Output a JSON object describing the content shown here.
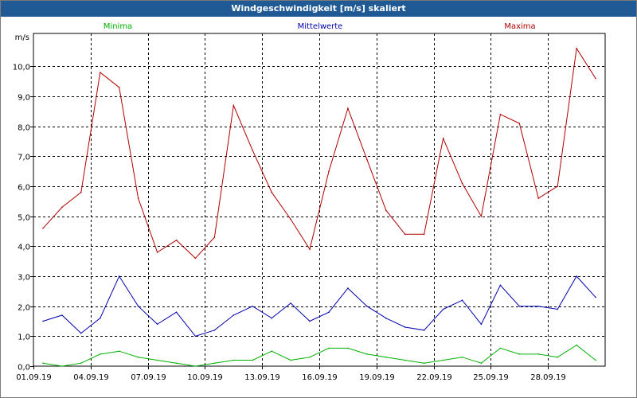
{
  "window": {
    "title": "Windgeschwindigkeit [m/s] skaliert"
  },
  "chart_data": {
    "type": "line",
    "y_unit_label": "m/s",
    "ylim": [
      0,
      11.1
    ],
    "y_ticks": [
      {
        "value": 0,
        "label": "0,0"
      },
      {
        "value": 1,
        "label": "1,0"
      },
      {
        "value": 2,
        "label": "2,0"
      },
      {
        "value": 3,
        "label": "3,0"
      },
      {
        "value": 4,
        "label": "4,0"
      },
      {
        "value": 5,
        "label": "5,0"
      },
      {
        "value": 6,
        "label": "6,0"
      },
      {
        "value": 7,
        "label": "7,0"
      },
      {
        "value": 8,
        "label": "8,0"
      },
      {
        "value": 9,
        "label": "9,0"
      },
      {
        "value": 10,
        "label": "10,0"
      }
    ],
    "x_ticks": [
      "01.09.19",
      "04.09.19",
      "07.09.19",
      "10.09.19",
      "13.09.19",
      "16.09.19",
      "19.09.19",
      "22.09.19",
      "25.09.19",
      "28.09.19"
    ],
    "xlim": [
      "2019-09-01",
      "2019-10-01"
    ],
    "grid": true,
    "legend_position": "top",
    "x": [
      "2019-09-01",
      "2019-09-02",
      "2019-09-03",
      "2019-09-04",
      "2019-09-05",
      "2019-09-06",
      "2019-09-07",
      "2019-09-08",
      "2019-09-09",
      "2019-09-10",
      "2019-09-11",
      "2019-09-12",
      "2019-09-13",
      "2019-09-14",
      "2019-09-15",
      "2019-09-16",
      "2019-09-17",
      "2019-09-18",
      "2019-09-19",
      "2019-09-20",
      "2019-09-21",
      "2019-09-22",
      "2019-09-23",
      "2019-09-24",
      "2019-09-25",
      "2019-09-26",
      "2019-09-27",
      "2019-09-28",
      "2019-09-29",
      "2019-09-30"
    ],
    "series": [
      {
        "name": "Minima",
        "color": "#00b000",
        "values": [
          0.1,
          0.0,
          0.1,
          0.4,
          0.5,
          0.3,
          0.2,
          0.1,
          0.0,
          0.1,
          0.2,
          0.2,
          0.5,
          0.2,
          0.3,
          0.6,
          0.6,
          0.4,
          0.3,
          0.2,
          0.1,
          0.2,
          0.3,
          0.1,
          0.6,
          0.4,
          0.4,
          0.3,
          0.7,
          0.2
        ]
      },
      {
        "name": "Mittelwerte",
        "color": "#0000b0",
        "values": [
          1.5,
          1.7,
          1.1,
          1.6,
          3.0,
          2.0,
          1.4,
          1.8,
          1.0,
          1.2,
          1.7,
          2.0,
          1.6,
          2.1,
          1.5,
          1.8,
          2.6,
          2.0,
          1.6,
          1.3,
          1.2,
          1.9,
          2.2,
          1.4,
          2.7,
          2.0,
          2.0,
          1.9,
          3.0,
          2.3
        ]
      },
      {
        "name": "Maxima",
        "color": "#b00000",
        "values": [
          4.6,
          5.3,
          5.8,
          9.8,
          9.3,
          5.6,
          3.8,
          4.2,
          3.6,
          4.3,
          8.7,
          7.2,
          5.8,
          4.9,
          3.9,
          6.5,
          8.6,
          6.9,
          5.2,
          4.4,
          4.4,
          7.6,
          6.1,
          5.0,
          8.4,
          8.1,
          5.6,
          6.0,
          10.6,
          9.6
        ]
      }
    ]
  }
}
